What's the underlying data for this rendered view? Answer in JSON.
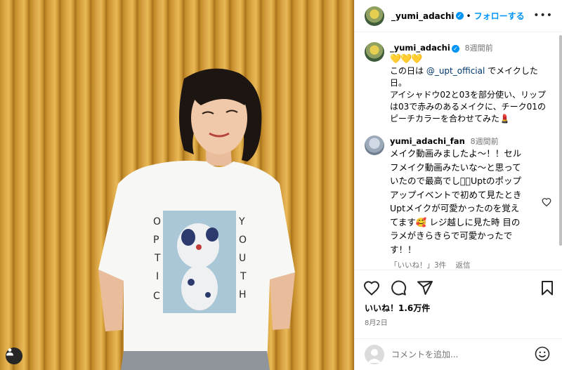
{
  "post": {
    "author": "_yumi_adachi",
    "follow_label": "フォローする",
    "separator": "•",
    "more_label": "•••"
  },
  "caption": {
    "author": "_yumi_adachi",
    "time": "8週間前",
    "hearts": "💛💛💛",
    "line1_pre": "この日は ",
    "mention": "@_upt_official",
    "line1_post": " でメイクした日。",
    "line2": "アイシャドウ02と03を部分使い、リップは03で赤みのあるメイクに、チーク01のピーチカラーを合わせてみた💄"
  },
  "comment": {
    "author": "yumi_adachi_fan",
    "time": "8週間前",
    "text": "メイク動画みましたよ〜！！セルフメイク動画みたいな〜と思っていたので最高でした🏻Uptのポップアップイベントで初めて見たとき Uptメイクが可愛かったのを覚えてます🥰 レジ越しに見た時 目のラメがきらきらで可愛かったです！！",
    "likes_label": "「いいね！」3件",
    "reply_label": "返信"
  },
  "footer": {
    "likes_text": "いいね！1.6万件",
    "date": "8月2日"
  },
  "composer": {
    "placeholder": "コメントを追加..."
  },
  "icons": {
    "like": "heart-icon",
    "comment": "comment-icon",
    "share": "share-icon",
    "save": "bookmark-icon",
    "emoji": "emoji-icon",
    "tags": "user-tag-icon"
  },
  "colors": {
    "accent": "#0095f6",
    "verified": "#0095f6",
    "muted": "#737373"
  }
}
